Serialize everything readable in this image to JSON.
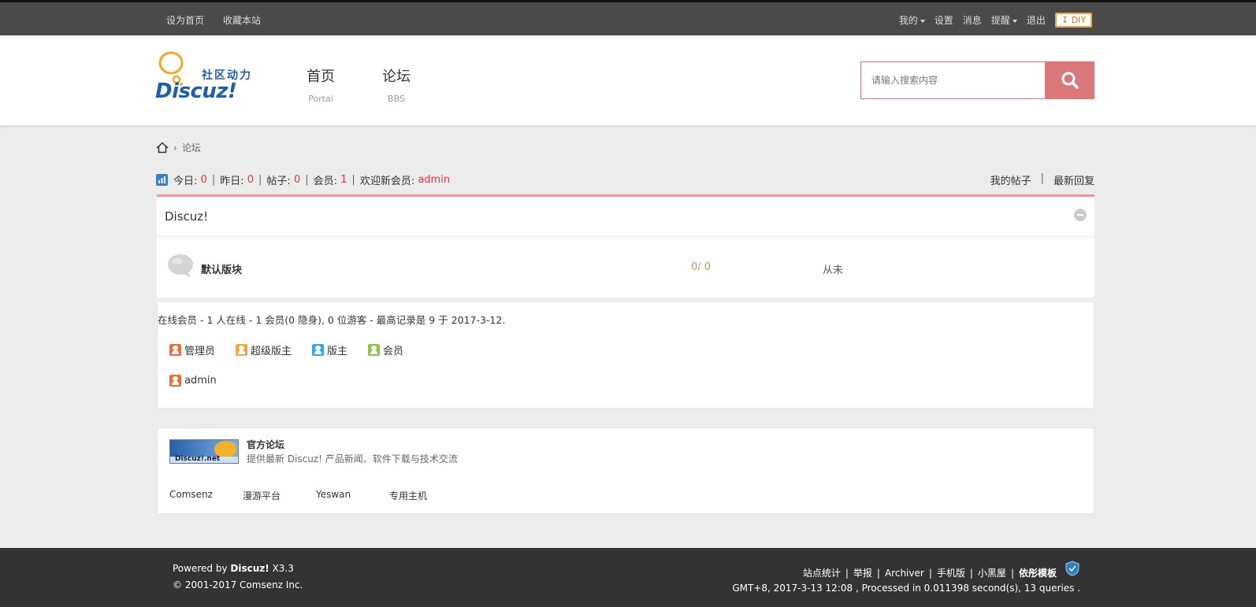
{
  "topbar": {
    "left_links": [
      "设为首页",
      "收藏本站"
    ],
    "right_links": [
      {
        "label": "我的",
        "dropdown": true
      },
      {
        "label": "设置",
        "dropdown": false
      },
      {
        "label": "消息",
        "dropdown": false
      },
      {
        "label": "提醒",
        "dropdown": true
      },
      {
        "label": "退出",
        "dropdown": false
      }
    ],
    "diy_label": "DIY"
  },
  "header": {
    "logo_text": "Discuz!",
    "logo_tagline": "社区动力",
    "nav": [
      {
        "label": "首页",
        "sub": "Portal"
      },
      {
        "label": "论坛",
        "sub": "BBS"
      }
    ],
    "search_placeholder": "请输入搜索内容"
  },
  "breadcrumb": {
    "current": "论坛"
  },
  "stats": {
    "today_label": "今日:",
    "today": "0",
    "yesterday_label": "昨日:",
    "yesterday": "0",
    "posts_label": "帖子:",
    "posts": "0",
    "members_label": "会员:",
    "members": "1",
    "welcome_label": "欢迎新会员:",
    "newest_member": "admin",
    "my_posts": "我的帖子",
    "latest_replies": "最新回复"
  },
  "forum_group": {
    "title": "Discuz!",
    "forums": [
      {
        "name": "默认版块",
        "counts": "0/ 0",
        "last_post": "从未"
      }
    ]
  },
  "online": {
    "summary": "在线会员 - 1 人在线 - 1 会员(0 隐身), 0 位游客 - 最高记录是 9 于 2017-3-12.",
    "legend": [
      {
        "label": "管理员",
        "color": "#f06b2d"
      },
      {
        "label": "超级版主",
        "color": "#f5a53a"
      },
      {
        "label": "版主",
        "color": "#3aa7e0"
      },
      {
        "label": "会员",
        "color": "#8cc63f"
      }
    ],
    "members": [
      {
        "name": "admin",
        "color": "#f06b2d"
      }
    ]
  },
  "friend_links": {
    "banner_text": "Discuz!.net",
    "title": "官方论坛",
    "description": "提供最新 Discuz! 产品新闻、软件下载与技术交流",
    "text_links": [
      "Comsenz",
      "漫游平台",
      "Yeswan",
      "专用主机"
    ]
  },
  "footer": {
    "powered_prefix": "Powered by",
    "powered_name": "Discuz!",
    "powered_version": "X3.3",
    "copyright": "© 2001-2017 Comsenz Inc.",
    "links": [
      "站点统计",
      "举报",
      "Archiver",
      "手机版",
      "小黑屋",
      "依彤模板"
    ],
    "stats": "GMT+8, 2017-3-13 12:08 , Processed in 0.011398 second(s), 13 queries ."
  },
  "colors": {
    "accent_red": "#e0393e",
    "search_button": "#d9787a",
    "forum_border": "#f19494",
    "topbar": "#4a4a4a",
    "footer": "#333333"
  }
}
